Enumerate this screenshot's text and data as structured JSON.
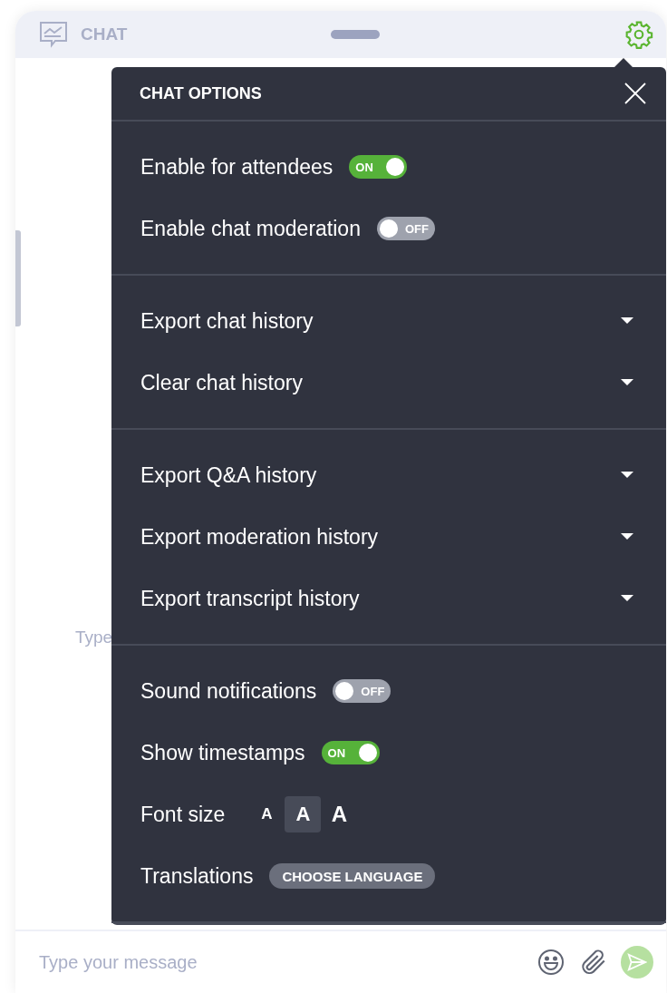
{
  "header": {
    "title": "CHAT"
  },
  "background": {
    "hint": "Type"
  },
  "options_panel": {
    "title": "CHAT OPTIONS",
    "sections": [
      {
        "items": [
          {
            "kind": "toggle",
            "label": "Enable for attendees",
            "on": true,
            "state_text": "ON"
          },
          {
            "kind": "toggle",
            "label": "Enable chat moderation",
            "on": false,
            "state_text": "OFF"
          }
        ]
      },
      {
        "items": [
          {
            "kind": "dropdown",
            "label": "Export chat history"
          },
          {
            "kind": "dropdown",
            "label": "Clear chat history"
          }
        ]
      },
      {
        "items": [
          {
            "kind": "dropdown",
            "label": "Export Q&A history"
          },
          {
            "kind": "dropdown",
            "label": "Export moderation history"
          },
          {
            "kind": "dropdown",
            "label": "Export transcript history"
          }
        ]
      },
      {
        "items": [
          {
            "kind": "toggle",
            "label": "Sound notifications",
            "on": false,
            "state_text": "OFF"
          },
          {
            "kind": "toggle",
            "label": "Show timestamps",
            "on": true,
            "state_text": "ON"
          },
          {
            "kind": "font_size",
            "label": "Font size",
            "options": [
              {
                "text": "A",
                "selected": false
              },
              {
                "text": "A",
                "selected": true
              },
              {
                "text": "A",
                "selected": false
              }
            ]
          },
          {
            "kind": "button",
            "label": "Translations",
            "button": "CHOOSE LANGUAGE"
          }
        ]
      }
    ]
  },
  "composer": {
    "placeholder": "Type your message"
  }
}
